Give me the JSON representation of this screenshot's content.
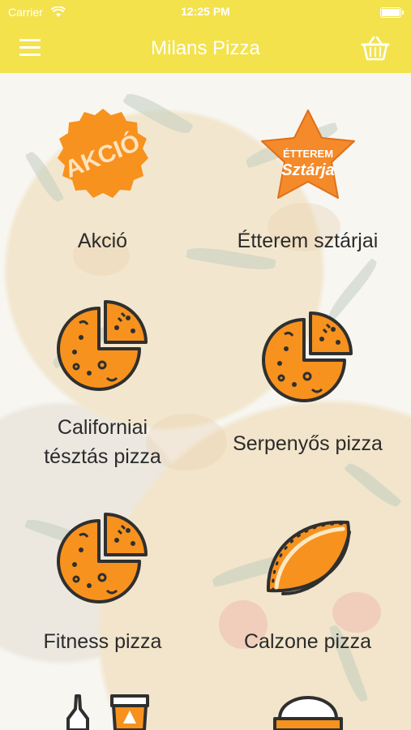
{
  "status_bar": {
    "carrier": "Carrier",
    "time": "12:25 PM"
  },
  "nav": {
    "title": "Milans Pizza",
    "menu_icon": "hamburger-menu-icon",
    "cart_icon": "basket-icon"
  },
  "badges": {
    "akcio": "AKCIÓ",
    "etterem_top": "ÉTTEREM",
    "etterem_bottom": "Sztárja"
  },
  "categories": [
    {
      "label": "Akció",
      "icon": "sale-badge-icon"
    },
    {
      "label": "Étterem sztárjai",
      "icon": "star-badge-icon"
    },
    {
      "label_line1": "Californiai",
      "label_line2": "tésztás pizza",
      "icon": "pizza-icon"
    },
    {
      "label": "Serpenyős pizza",
      "icon": "pizza-icon"
    },
    {
      "label": "Fitness pizza",
      "icon": "pizza-icon"
    },
    {
      "label": "Calzone pizza",
      "icon": "calzone-icon"
    }
  ],
  "colors": {
    "accent": "#f3e24c",
    "orange": "#f7921e",
    "outline": "#2f2f2f"
  }
}
